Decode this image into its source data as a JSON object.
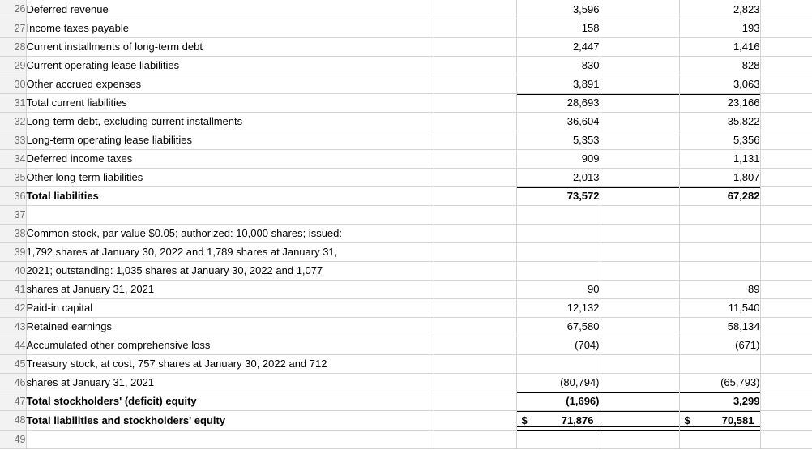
{
  "app": {
    "kind": "spreadsheet",
    "grid_line_color": "#d4d4d4",
    "row_header_background": "#f2f2f2",
    "row_header_text_color": "#6f6f6f",
    "rule_color": "#000000"
  },
  "columns": {
    "row_header": "",
    "a_label": "",
    "b_spacer": "",
    "c_value_2022": "",
    "d_spacer": "",
    "e_value_2021": "",
    "f_spacer": ""
  },
  "rows": [
    {
      "n": "26",
      "label": "Deferred revenue",
      "bold": false,
      "v2022": "3,596",
      "v2021": "2,823"
    },
    {
      "n": "27",
      "label": "Income taxes payable",
      "bold": false,
      "v2022": "158",
      "v2021": "193"
    },
    {
      "n": "28",
      "label": "Current installments of long-term debt",
      "bold": false,
      "v2022": "2,447",
      "v2021": "1,416"
    },
    {
      "n": "29",
      "label": "Current operating lease liabilities",
      "bold": false,
      "v2022": "830",
      "v2021": "828"
    },
    {
      "n": "30",
      "label": "Other accrued expenses",
      "bold": false,
      "v2022": "3,891",
      "v2021": "3,063"
    },
    {
      "n": "31",
      "label": "Total current liabilities",
      "bold": false,
      "v2022": "28,693",
      "v2021": "23,166"
    },
    {
      "n": "32",
      "label": "Long-term debt, excluding current installments",
      "bold": false,
      "v2022": "36,604",
      "v2021": "35,822"
    },
    {
      "n": "33",
      "label": "Long-term operating lease liabilities",
      "bold": false,
      "v2022": "5,353",
      "v2021": "5,356"
    },
    {
      "n": "34",
      "label": "Deferred income taxes",
      "bold": false,
      "v2022": "909",
      "v2021": "1,131"
    },
    {
      "n": "35",
      "label": "Other long-term liabilities",
      "bold": false,
      "v2022": "2,013",
      "v2021": "1,807"
    },
    {
      "n": "36",
      "label": "Total liabilities",
      "bold": true,
      "v2022": "73,572",
      "v2021": "67,282"
    },
    {
      "n": "37",
      "label": "",
      "bold": false,
      "v2022": "",
      "v2021": ""
    },
    {
      "n": "38",
      "label": "Common stock, par value $0.05; authorized: 10,000 shares; issued:",
      "bold": false,
      "v2022": "",
      "v2021": ""
    },
    {
      "n": "39",
      "label": "1,792 shares at January 30, 2022 and 1,789 shares at January 31,",
      "bold": false,
      "v2022": "",
      "v2021": ""
    },
    {
      "n": "40",
      "label": "2021; outstanding: 1,035 shares at January 30, 2022 and 1,077",
      "bold": false,
      "v2022": "",
      "v2021": ""
    },
    {
      "n": "41",
      "label": "shares at January 31, 2021",
      "bold": false,
      "v2022": "90",
      "v2021": "89"
    },
    {
      "n": "42",
      "label": "Paid-in capital",
      "bold": false,
      "v2022": "12,132",
      "v2021": "11,540"
    },
    {
      "n": "43",
      "label": "Retained earnings",
      "bold": false,
      "v2022": "67,580",
      "v2021": "58,134"
    },
    {
      "n": "44",
      "label": "Accumulated other comprehensive loss",
      "bold": false,
      "v2022": "(704)",
      "v2021": "(671)"
    },
    {
      "n": "45",
      "label": "Treasury stock, at cost, 757 shares at January 30, 2022 and 712",
      "bold": false,
      "v2022": "",
      "v2021": ""
    },
    {
      "n": "46",
      "label": "shares at January 31, 2021",
      "bold": false,
      "v2022": "(80,794)",
      "v2021": "(65,793)"
    },
    {
      "n": "47",
      "label": "Total stockholders' (deficit) equity",
      "bold": true,
      "v2022": "(1,696)",
      "v2021": "3,299"
    },
    {
      "n": "48",
      "label": "Total liabilities and stockholders' equity",
      "bold": true,
      "v2022": "71,876",
      "v2021": "70,581",
      "currency": "$"
    },
    {
      "n": "49",
      "label": "",
      "bold": false,
      "v2022": "",
      "v2021": ""
    }
  ]
}
